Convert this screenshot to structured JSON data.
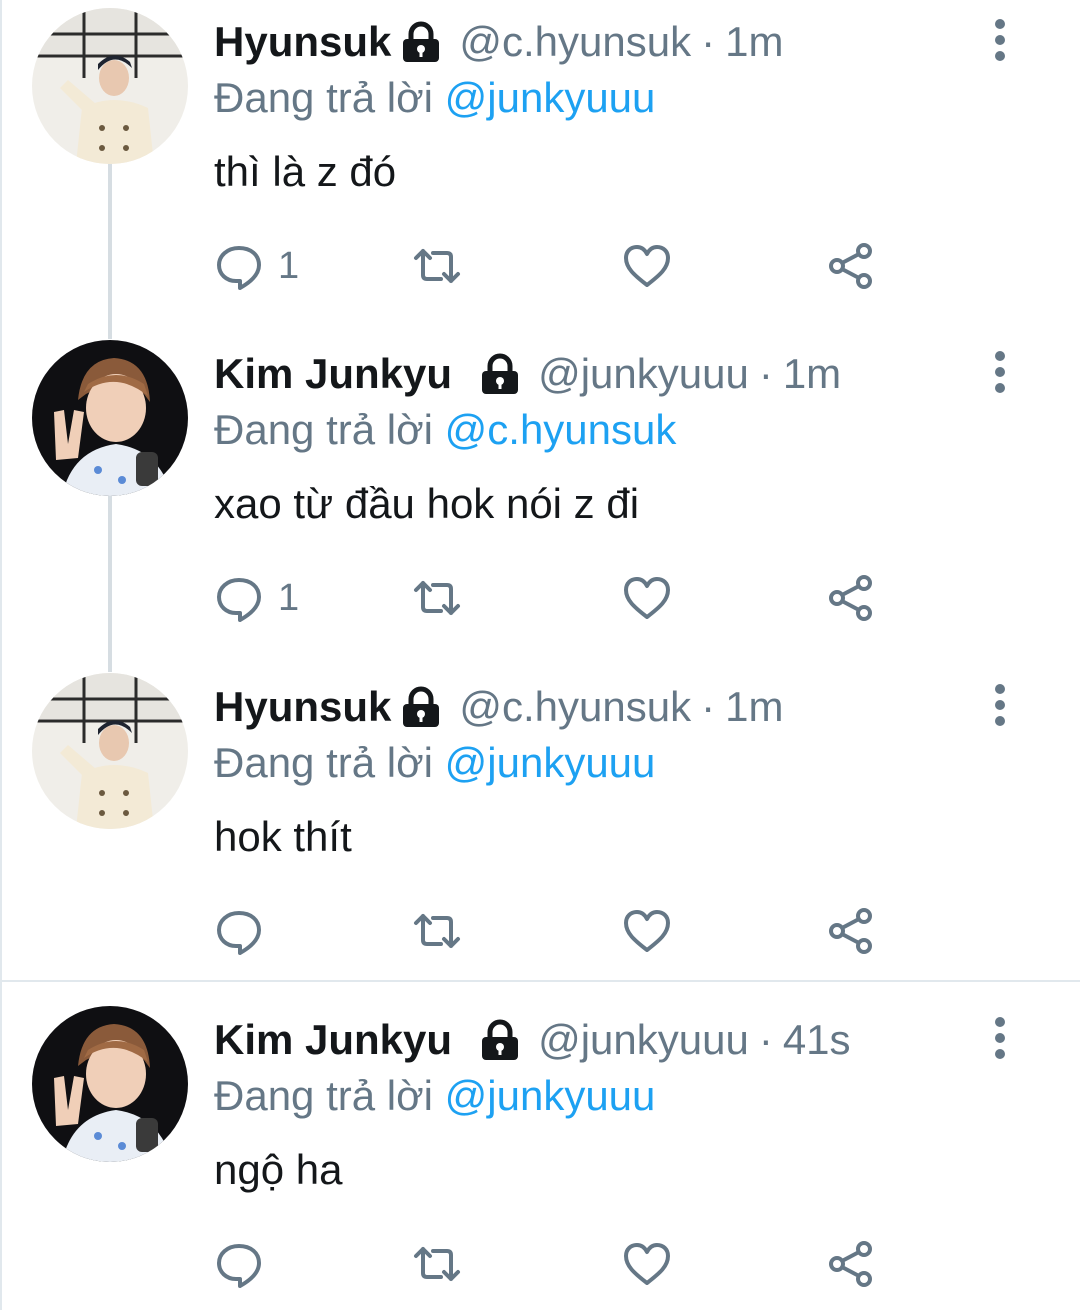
{
  "colors": {
    "text_primary": "#14171a",
    "text_secondary": "#657786",
    "mention_blue": "#1da1f2",
    "thread_line": "#d6dde2",
    "divider": "#e1e8ed"
  },
  "icons": {
    "lock": "lock-icon",
    "more": "more-vertical-icon",
    "reply": "reply-bubble-icon",
    "retweet": "retweet-icon",
    "like": "heart-icon",
    "share": "share-icon"
  },
  "tweets": [
    {
      "author_name": "Hyunsuk",
      "handle": "@c.hyunsuk",
      "separator": "·",
      "time": "1m",
      "reply_prefix": "Đang trả lời",
      "reply_to": "@junkyuuu",
      "text": "thì là z đó",
      "reply_count": "1"
    },
    {
      "author_name": "Kim Junkyu",
      "handle": "@junkyuuu",
      "separator": "·",
      "time": "1m",
      "reply_prefix": "Đang trả lời",
      "reply_to": "@c.hyunsuk",
      "text": "xao từ đầu hok nói z đi",
      "reply_count": "1"
    },
    {
      "author_name": "Hyunsuk",
      "handle": "@c.hyunsuk",
      "separator": "·",
      "time": "1m",
      "reply_prefix": "Đang trả lời",
      "reply_to": "@junkyuuu",
      "text": "hok thít",
      "reply_count": ""
    },
    {
      "author_name": "Kim Junkyu",
      "handle": "@junkyuuu",
      "separator": "·",
      "time": "41s",
      "reply_prefix": "Đang trả lời",
      "reply_to": "@junkyuuu",
      "text": "ngộ ha",
      "reply_count": ""
    }
  ]
}
